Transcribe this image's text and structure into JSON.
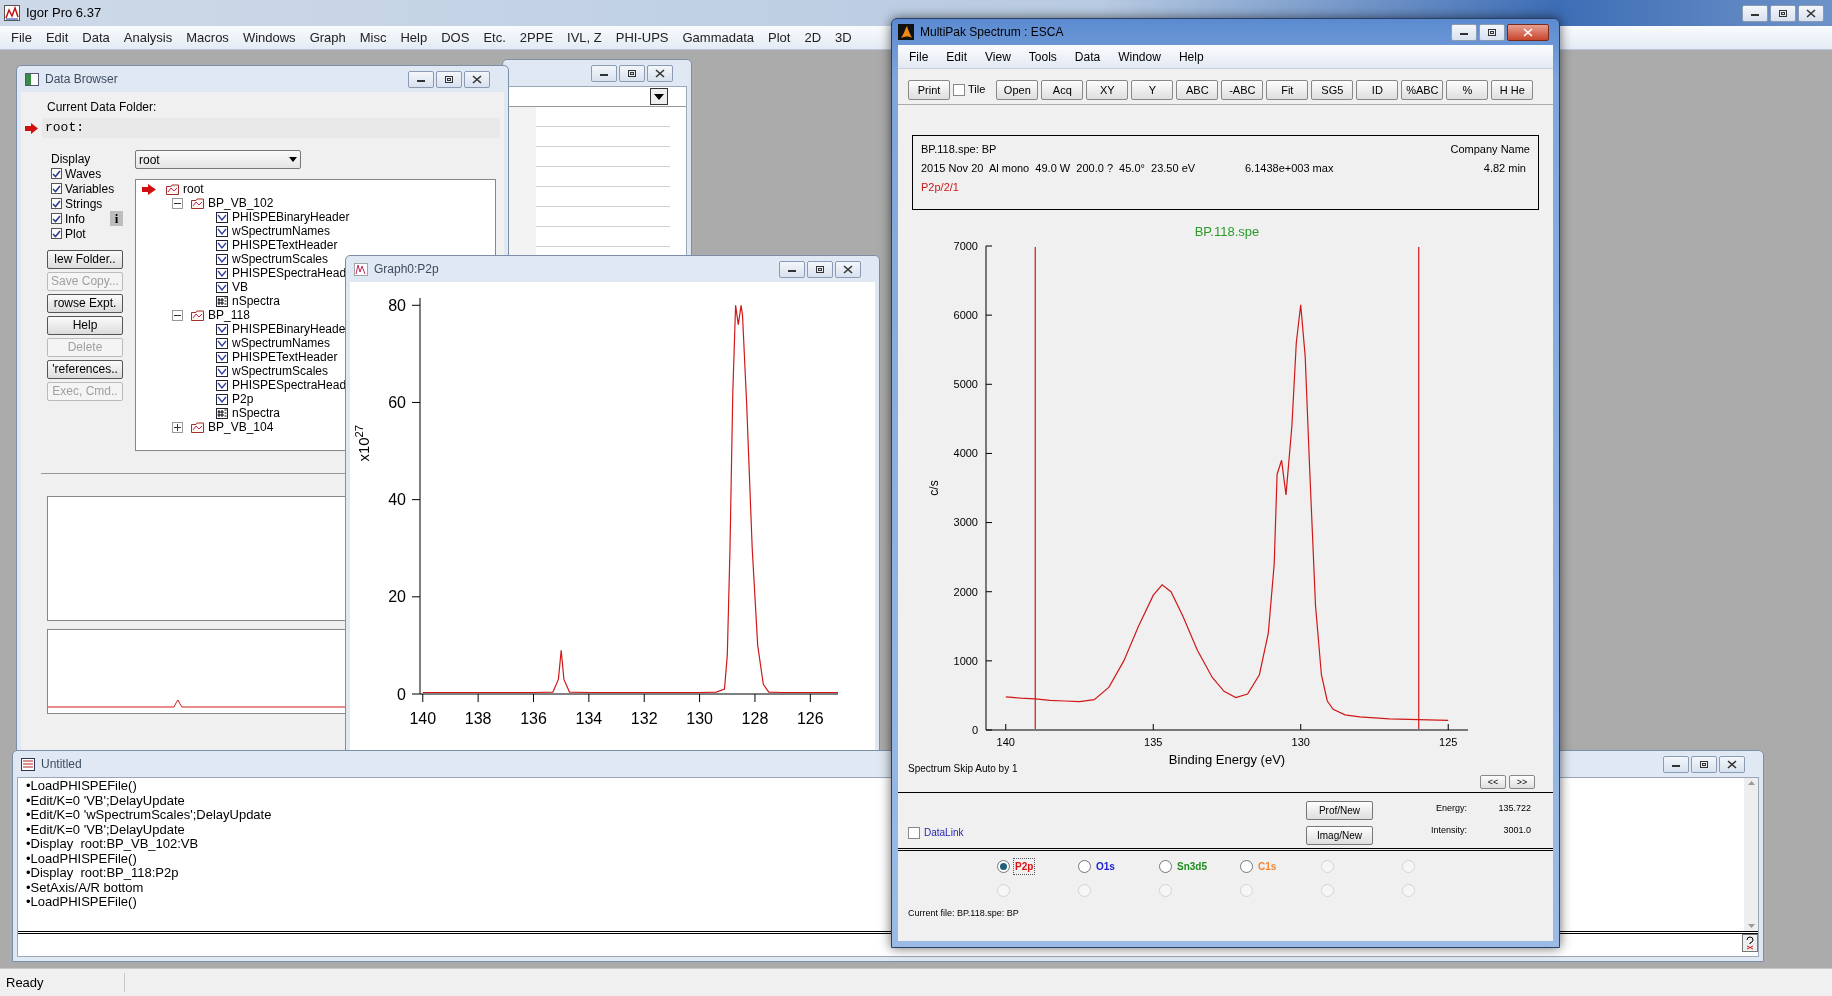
{
  "app": {
    "title": "Igor Pro 6.37"
  },
  "menu_bar": [
    "File",
    "Edit",
    "Data",
    "Analysis",
    "Macros",
    "Windows",
    "Graph",
    "Misc",
    "Help",
    "DOS",
    "Etc.",
    "2PPE",
    "IVL, Z",
    "PHI-UPS",
    "Gammadata",
    "Plot",
    "2D",
    "3D"
  ],
  "data_browser": {
    "title": "Data Browser",
    "current_folder_label": "Current Data Folder:",
    "current_folder": "root:",
    "display_label": "Display",
    "display_options": [
      {
        "label": "Waves",
        "checked": true
      },
      {
        "label": "Variables",
        "checked": true
      },
      {
        "label": "Strings",
        "checked": true
      },
      {
        "label": "Info",
        "checked": true
      },
      {
        "label": "Plot",
        "checked": true
      }
    ],
    "info_button": "i",
    "folder_select": "root",
    "buttons": [
      {
        "label": "lew Folder..",
        "disabled": false
      },
      {
        "label": "Save Copy...",
        "disabled": true
      },
      {
        "label": "rowse Expt.",
        "disabled": false
      },
      {
        "label": "Help",
        "disabled": false
      },
      {
        "label": "Delete",
        "disabled": true
      },
      {
        "label": "'references..",
        "disabled": false
      },
      {
        "label": "Exec, Cmd..",
        "disabled": true
      }
    ],
    "tree": [
      {
        "label": "root",
        "kind": "folder",
        "current": true,
        "children": [
          {
            "label": "BP_VB_102",
            "kind": "folder",
            "current": false,
            "expanded": true,
            "children": [
              {
                "label": "PHISPEBinaryHeader",
                "kind": "wave",
                "current": false
              },
              {
                "label": "wSpectrumNames",
                "kind": "wave",
                "current": false
              },
              {
                "label": "PHISPETextHeader",
                "kind": "wave",
                "current": false
              },
              {
                "label": "wSpectrumScales",
                "kind": "wave",
                "current": false
              },
              {
                "label": "PHISPESpectraHead",
                "kind": "wave",
                "current": false
              },
              {
                "label": "VB",
                "kind": "wave",
                "current": false
              },
              {
                "label": "nSpectra",
                "kind": "variable",
                "current": false
              }
            ]
          },
          {
            "label": "BP_118",
            "kind": "folder",
            "current": false,
            "expanded": true,
            "children": [
              {
                "label": "PHISPEBinaryHeade",
                "kind": "wave",
                "current": false
              },
              {
                "label": "wSpectrumNames",
                "kind": "wave",
                "current": false
              },
              {
                "label": "PHISPETextHeader",
                "kind": "wave",
                "current": false
              },
              {
                "label": "wSpectrumScales",
                "kind": "wave",
                "current": false
              },
              {
                "label": "PHISPESpectraHead",
                "kind": "wave",
                "current": false
              },
              {
                "label": "P2p",
                "kind": "wave",
                "current": false
              },
              {
                "label": "nSpectra",
                "kind": "variable",
                "current": false
              }
            ]
          },
          {
            "label": "BP_VB_104",
            "kind": "folder",
            "current": false,
            "expanded": false
          }
        ]
      }
    ]
  },
  "graph_window": {
    "title": "Graph0:P2p",
    "chart_data": {
      "type": "line",
      "ylabel": "x10$^{27}$",
      "x": [
        140,
        139,
        138,
        137,
        136,
        135.3,
        135.1,
        135.0,
        134.9,
        134.7,
        134,
        133,
        132,
        131,
        130,
        129.4,
        129.1,
        129.0,
        128.9,
        128.8,
        128.7,
        128.6,
        128.5,
        128.45,
        128.3,
        128.1,
        127.9,
        127.7,
        127.5,
        127,
        126,
        125
      ],
      "series": [
        {
          "color": "#d01818",
          "values": [
            0.3,
            0.3,
            0.3,
            0.3,
            0.3,
            0.4,
            3,
            9,
            3,
            0.4,
            0.3,
            0.3,
            0.3,
            0.3,
            0.3,
            0.4,
            1,
            8,
            30,
            62,
            80,
            76,
            80,
            78,
            60,
            30,
            10,
            2,
            0.4,
            0.3,
            0.3,
            0.3
          ]
        }
      ],
      "xlim": [
        140.1,
        125
      ],
      "ylim": [
        0,
        81.5
      ],
      "xticks": [
        140,
        138,
        136,
        134,
        132,
        130,
        128,
        126
      ],
      "yticks": [
        0,
        20,
        40,
        60,
        80
      ]
    }
  },
  "command_window": {
    "title": "Untitled",
    "history": [
      "•LoadPHISPEFile()",
      "•Edit/K=0 'VB';DelayUpdate",
      "•Edit/K=0 'wSpectrumScales';DelayUpdate",
      "•Edit/K=0 'VB';DelayUpdate",
      "•Display  root:BP_VB_102:VB",
      "•LoadPHISPEFile()",
      "•Display  root:BP_118:P2p",
      "•SetAxis/A/R bottom",
      "•LoadPHISPEFile()"
    ]
  },
  "multipak": {
    "title": "MultiPak Spectrum : ESCA",
    "menu": [
      "File",
      "Edit",
      "View",
      "Tools",
      "Data",
      "Window",
      "Help"
    ],
    "toolbar": [
      {
        "kind": "button",
        "label": "Print"
      },
      {
        "kind": "checkbox",
        "label": "Tile",
        "checked": false
      },
      {
        "kind": "button",
        "label": "Open"
      },
      {
        "kind": "button",
        "label": "Acq"
      },
      {
        "kind": "button",
        "label": "XY"
      },
      {
        "kind": "button",
        "label": "Y"
      },
      {
        "kind": "button",
        "label": "ABC"
      },
      {
        "kind": "button",
        "label": "-ABC"
      },
      {
        "kind": "button",
        "label": "Fit"
      },
      {
        "kind": "button",
        "label": "SG5"
      },
      {
        "kind": "button",
        "label": "ID"
      },
      {
        "kind": "button",
        "label": "%ABC"
      },
      {
        "kind": "button",
        "label": "%"
      },
      {
        "kind": "button",
        "label": "H He"
      }
    ],
    "info": {
      "file": "BP.118.spe: BP",
      "company": "Company Name",
      "parameters": "2015 Nov 20  Al mono  49.0 W  200.0 ?  45.0°  23.50 eV",
      "maximum": "6.1438e+003 max",
      "time": "4.82 min",
      "region": "P2p/2/1"
    },
    "chart_data": {
      "type": "line",
      "title": "BP.118.spe",
      "xlabel": "Binding Energy (eV)",
      "ylabel": "c/s",
      "x": [
        140,
        139.5,
        139,
        138.5,
        138,
        137.5,
        137,
        136.5,
        136,
        135.5,
        135,
        134.7,
        134.4,
        134,
        133.5,
        133,
        132.6,
        132.2,
        131.8,
        131.4,
        131.1,
        130.9,
        130.8,
        130.65,
        130.5,
        130.3,
        130.15,
        130,
        129.85,
        129.7,
        129.5,
        129.3,
        129.1,
        128.9,
        128.5,
        128,
        127,
        126,
        125
      ],
      "series": [
        {
          "color": "#d01818",
          "values": [
            480,
            460,
            450,
            430,
            420,
            410,
            440,
            620,
            1000,
            1500,
            1950,
            2100,
            2000,
            1650,
            1150,
            760,
            560,
            470,
            520,
            800,
            1400,
            2400,
            3700,
            3900,
            3400,
            4400,
            5600,
            6150,
            5400,
            3800,
            1800,
            800,
            420,
            300,
            220,
            190,
            160,
            150,
            140
          ]
        }
      ],
      "xlim": [
        140.67,
        124.33
      ],
      "ylim": [
        0,
        7000
      ],
      "xticks": [
        140,
        135,
        130,
        125
      ],
      "yticks": [
        0,
        1000,
        2000,
        3000,
        4000,
        5000,
        6000,
        7000
      ],
      "ref_lines": [
        {
          "axis": "x",
          "value": 139
        },
        {
          "axis": "x",
          "value": 126
        }
      ]
    },
    "skip_label": "Spectrum Skip Auto by 1",
    "nav_buttons": [
      "<<",
      ">>"
    ],
    "action_buttons": [
      "Prof/New",
      "Imag/New"
    ],
    "readouts": [
      {
        "label": "Energy:",
        "value": "135.722"
      },
      {
        "label": "Intensity:",
        "value": "3001.0"
      }
    ],
    "datalink": {
      "label": "DataLink",
      "checked": false
    },
    "regions": [
      {
        "label": "P2p",
        "color": "#e01010",
        "selected": true
      },
      {
        "label": "O1s",
        "color": "#1a1ad0",
        "selected": false
      },
      {
        "label": "Sn3d5",
        "color": "#1f8a1f",
        "selected": false
      },
      {
        "label": "C1s",
        "color": "#f0883a",
        "selected": false
      },
      {
        "selected": false
      },
      {
        "selected": false
      },
      {
        "selected": false
      },
      {
        "selected": false
      },
      {
        "selected": false
      },
      {
        "selected": false
      },
      {
        "selected": false
      },
      {
        "selected": false
      }
    ],
    "current_file": "Current file: BP.118.spe: BP"
  },
  "status_bar": "Ready"
}
